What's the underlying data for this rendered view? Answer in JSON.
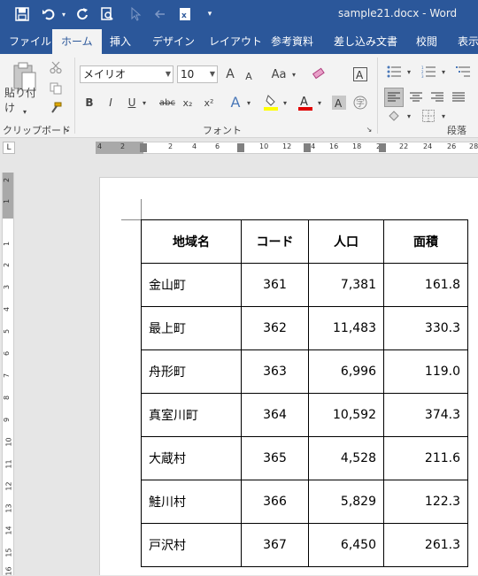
{
  "window": {
    "title": "sample21.docx  -  Word"
  },
  "ribbon_tabs": [
    "ファイル",
    "ホーム",
    "挿入",
    "デザイン",
    "レイアウト",
    "参考資料",
    "差し込み文書",
    "校閲",
    "表示"
  ],
  "active_tab": "ホーム",
  "clipboard": {
    "paste_label": "貼り付け",
    "group_label": "クリップボード"
  },
  "font": {
    "font_name": "メイリオ",
    "font_size": "10",
    "group_label": "フォント",
    "bold": "B",
    "italic": "I",
    "underline": "U",
    "strike": "abc",
    "subscript": "x₂",
    "superscript": "x²",
    "case": "Aa",
    "grow": "A",
    "shrink": "A",
    "clear": "A",
    "effects": "A",
    "char_shading": "A",
    "enclosed": "字"
  },
  "paragraph": {
    "group_label": "段落"
  },
  "ruler": {
    "corner": "L",
    "h_numbers": [
      "4",
      "2",
      "2",
      "4",
      "6",
      "8",
      "10",
      "12",
      "14",
      "16",
      "18",
      "20",
      "22",
      "24",
      "26",
      "28"
    ],
    "v_numbers": [
      "2",
      "1",
      "1",
      "2",
      "3",
      "4",
      "5",
      "6",
      "7",
      "8",
      "9",
      "10",
      "11",
      "12",
      "13",
      "14",
      "15",
      "16"
    ]
  },
  "table": {
    "headers": [
      "地域名",
      "コード",
      "人口",
      "面積"
    ],
    "rows": [
      [
        "金山町",
        "361",
        "7,381",
        "161.8"
      ],
      [
        "最上町",
        "362",
        "11,483",
        "330.3"
      ],
      [
        "舟形町",
        "363",
        "6,996",
        "119.0"
      ],
      [
        "真室川町",
        "364",
        "10,592",
        "374.3"
      ],
      [
        "大蔵村",
        "365",
        "4,528",
        "211.6"
      ],
      [
        "鮭川村",
        "366",
        "5,829",
        "122.3"
      ],
      [
        "戸沢村",
        "367",
        "6,450",
        "261.3"
      ]
    ]
  },
  "colors": {
    "titlebar": "#2b579a",
    "ribbon": "#f3f3f3"
  }
}
